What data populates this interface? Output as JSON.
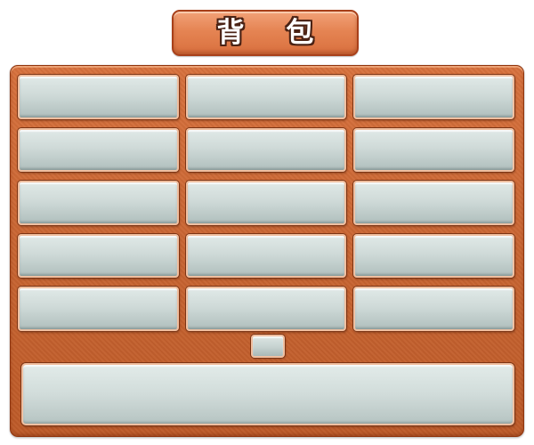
{
  "window": {
    "title": "背 包"
  },
  "inventory": {
    "columns": 3,
    "rows": 5,
    "slots": [
      {
        "item": ""
      },
      {
        "item": ""
      },
      {
        "item": ""
      },
      {
        "item": ""
      },
      {
        "item": ""
      },
      {
        "item": ""
      },
      {
        "item": ""
      },
      {
        "item": ""
      },
      {
        "item": ""
      },
      {
        "item": ""
      },
      {
        "item": ""
      },
      {
        "item": ""
      },
      {
        "item": ""
      },
      {
        "item": ""
      },
      {
        "item": ""
      }
    ]
  },
  "pagination": {
    "label": ""
  },
  "detail": {
    "text": ""
  },
  "colors": {
    "panel": "#c86532",
    "banner": "#e58453",
    "slot": "#cfdad8",
    "slot_border": "#f0bfa0",
    "title_outline": "#4a2214"
  }
}
